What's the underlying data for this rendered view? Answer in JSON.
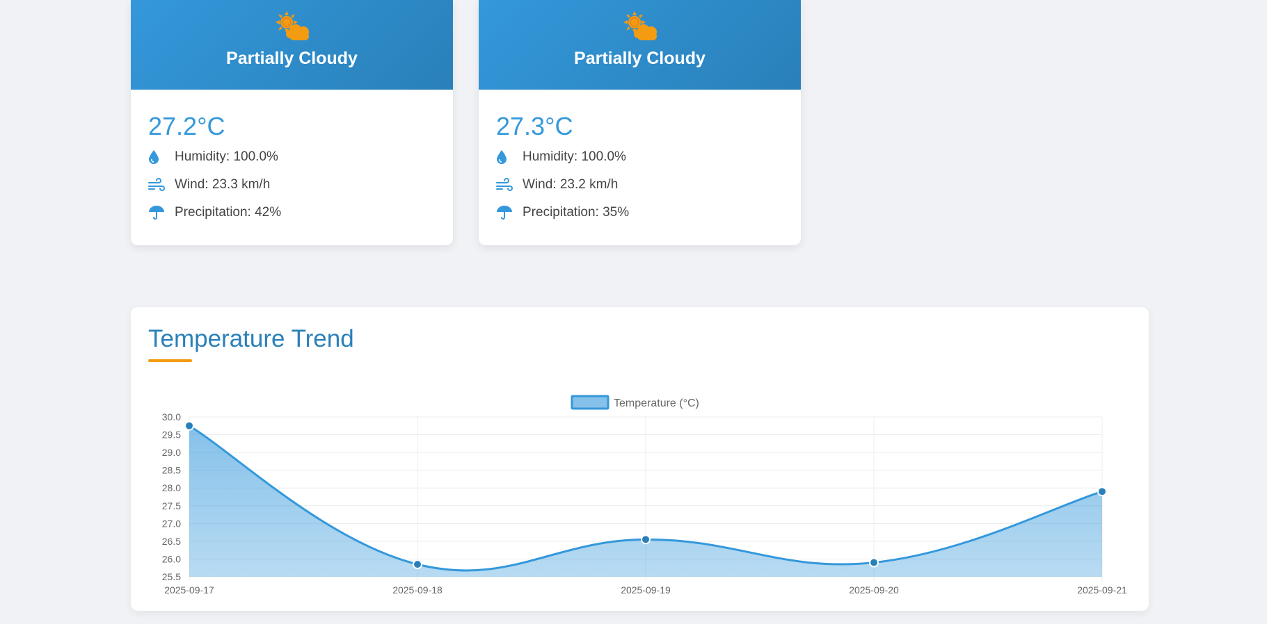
{
  "cards": [
    {
      "condition": "Partially Cloudy",
      "icon": "partly-cloudy-icon",
      "temperature": "27.2°C",
      "humidity": "Humidity: 100.0%",
      "wind": "Wind: 23.3 km/h",
      "precipitation": "Precipitation: 42%"
    },
    {
      "condition": "Partially Cloudy",
      "icon": "partly-cloudy-icon",
      "temperature": "27.3°C",
      "humidity": "Humidity: 100.0%",
      "wind": "Wind: 23.2 km/h",
      "precipitation": "Precipitation: 35%"
    }
  ],
  "colors": {
    "header_gradient_start": "#3498db",
    "header_gradient_end": "#2980b9",
    "accent": "#f39c12",
    "line": "#3498db",
    "point": "#2980b9"
  },
  "trend": {
    "heading": "Temperature Trend"
  },
  "chart_data": {
    "type": "area",
    "title": "",
    "x": [
      "2025-09-17",
      "2025-09-18",
      "2025-09-19",
      "2025-09-20",
      "2025-09-21"
    ],
    "series": [
      {
        "name": "Temperature (°C)",
        "values": [
          29.75,
          25.85,
          26.55,
          25.9,
          27.9
        ]
      }
    ],
    "yticks": [
      "30.0",
      "29.5",
      "29.0",
      "28.5",
      "28.0",
      "27.5",
      "27.0",
      "26.5",
      "26.0",
      "25.5"
    ],
    "ylim": [
      25.5,
      30.0
    ],
    "xlabel": "",
    "ylabel": "",
    "grid": true,
    "legend": "top-center"
  }
}
